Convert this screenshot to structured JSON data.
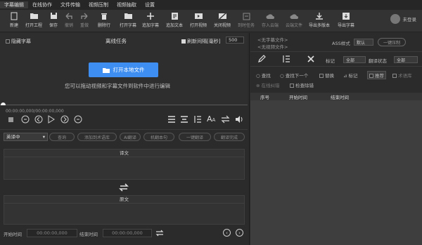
{
  "menu": [
    "字幕编辑",
    "在线协作",
    "文件传输",
    "视频压制",
    "视频抽取",
    "设置"
  ],
  "toolbar": [
    {
      "label": "新建",
      "icon": "new-file-icon",
      "dim": false
    },
    {
      "label": "打开工程",
      "icon": "open-project-icon",
      "dim": false
    },
    {
      "label": "保存",
      "icon": "save-icon",
      "dim": false
    },
    {
      "label": "撤销",
      "icon": "undo-icon",
      "dim": true
    },
    {
      "label": "重做",
      "icon": "redo-icon",
      "dim": true
    },
    {
      "label": "删除行",
      "icon": "delete-row-icon",
      "dim": false
    },
    {
      "label": "打开字幕",
      "icon": "open-subtitle-icon",
      "dim": false
    },
    {
      "label": "追加字幕",
      "icon": "add-subtitle-icon",
      "dim": false
    },
    {
      "label": "追加文本",
      "icon": "add-text-icon",
      "dim": false
    },
    {
      "label": "打开视频",
      "icon": "open-video-icon",
      "dim": false
    },
    {
      "label": "关闭视频",
      "icon": "close-video-icon",
      "dim": false
    },
    {
      "label": "到时任务",
      "icon": "scheduled-task-icon",
      "dim": true
    },
    {
      "label": "存入云端",
      "icon": "cloud-save-icon",
      "dim": true
    },
    {
      "label": "云端文件",
      "icon": "cloud-files-icon",
      "dim": true
    },
    {
      "label": "导出多版本",
      "icon": "export-multi-icon",
      "dim": false
    },
    {
      "label": "导出字幕",
      "icon": "export-subtitle-icon",
      "dim": false
    }
  ],
  "login_text": "未登录",
  "left": {
    "hide_subtitle": "隐藏字幕",
    "offline_task": "离线任务",
    "refresh_interval_label": "刷新间隔[毫秒]",
    "refresh_interval_value": "500",
    "open_local_file": "打开本地文件",
    "drag_hint": "您可以拖动视频和字幕文件到软件中进行编辑",
    "timecode": "00:00:00,000/00:00:00,000",
    "language": "英译中",
    "actions": [
      "查询",
      "添加到术语库",
      "AI翻译",
      "机翻本句",
      "一键翻译",
      "翻译完成"
    ],
    "translation_title": "译文",
    "original_title": "原文",
    "start_time_label": "开始时间",
    "start_time_value": "00:00:00,000",
    "end_time_label": "结束时间",
    "end_time_value": "00:00:00,000"
  },
  "right": {
    "no_subtitle_file": "<无字幕文件>",
    "no_video_file": "<无视频文件>",
    "ass_style_label": "ASS样式",
    "ass_style_value": "默认",
    "one_click_compress": "一键压制",
    "mark_label": "标记",
    "mark_value": "全部",
    "translate_status_label": "翻译状态",
    "translate_status_value": "全部",
    "find": "查找",
    "find_next": "查找下一个",
    "replace": "替换",
    "mark": "标记",
    "recommend": "推荐",
    "terms": "术语库",
    "online_proofread": "在线纠错",
    "check_duplicate": "检查除错",
    "columns": [
      "序号",
      "开始时间",
      "结束时间"
    ]
  },
  "colors": {
    "accent": "#3d8ef0",
    "background": "#2b2b2b"
  }
}
